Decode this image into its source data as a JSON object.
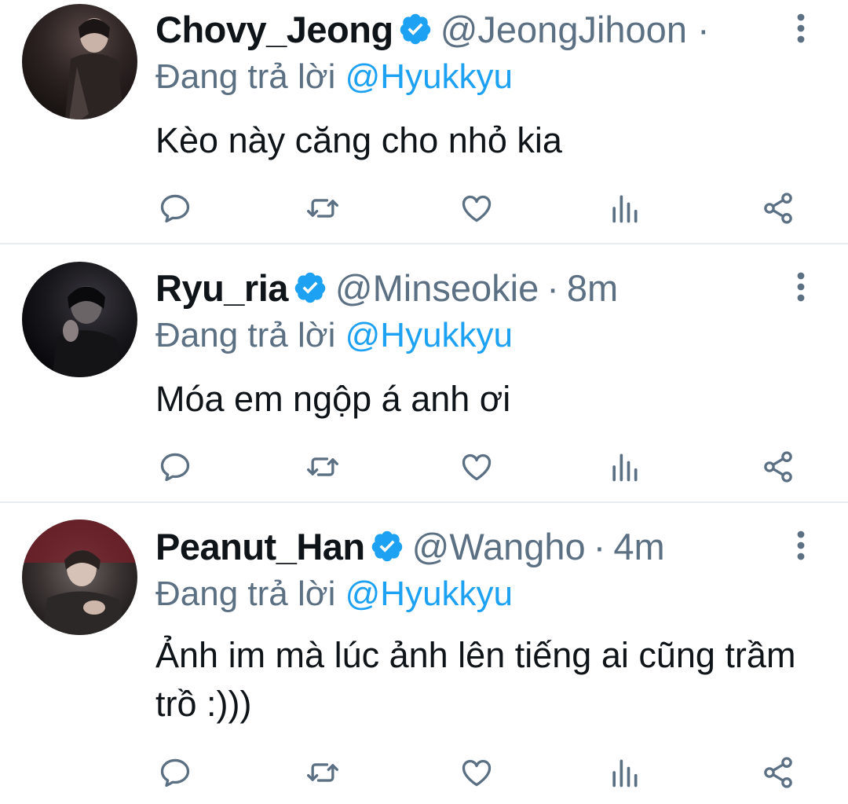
{
  "colors": {
    "primary_text": "#0f1419",
    "secondary_text": "#5b7083",
    "accent": "#1da1f2",
    "divider": "#e6ecf0"
  },
  "tweets": [
    {
      "display_name": "Chovy_Jeong",
      "handle": "@JeongJihoon",
      "separator": "·",
      "time": "",
      "verified": true,
      "reply_prefix": "Đang trả lời",
      "reply_mention": "@Hyukkyu",
      "text": "Kèo này căng cho nhỏ kia",
      "icons": [
        "reply-icon",
        "retweet-icon",
        "like-icon",
        "analytics-icon",
        "share-icon"
      ]
    },
    {
      "display_name": "Ryu_ria",
      "handle": "@Minseokie",
      "separator": "·",
      "time": "8m",
      "verified": true,
      "reply_prefix": "Đang trả lời",
      "reply_mention": "@Hyukkyu",
      "text": "Móa em ngộp á anh ơi",
      "icons": [
        "reply-icon",
        "retweet-icon",
        "like-icon",
        "analytics-icon",
        "share-icon"
      ]
    },
    {
      "display_name": "Peanut_Han",
      "handle": "@Wangho",
      "separator": "·",
      "time": "4m",
      "verified": true,
      "reply_prefix": "Đang trả lời",
      "reply_mention": "@Hyukkyu",
      "text": "Ảnh im mà lúc ảnh lên tiếng ai cũng trầm trồ :)))",
      "icons": [
        "reply-icon",
        "retweet-icon",
        "like-icon",
        "analytics-icon",
        "share-icon"
      ]
    }
  ]
}
